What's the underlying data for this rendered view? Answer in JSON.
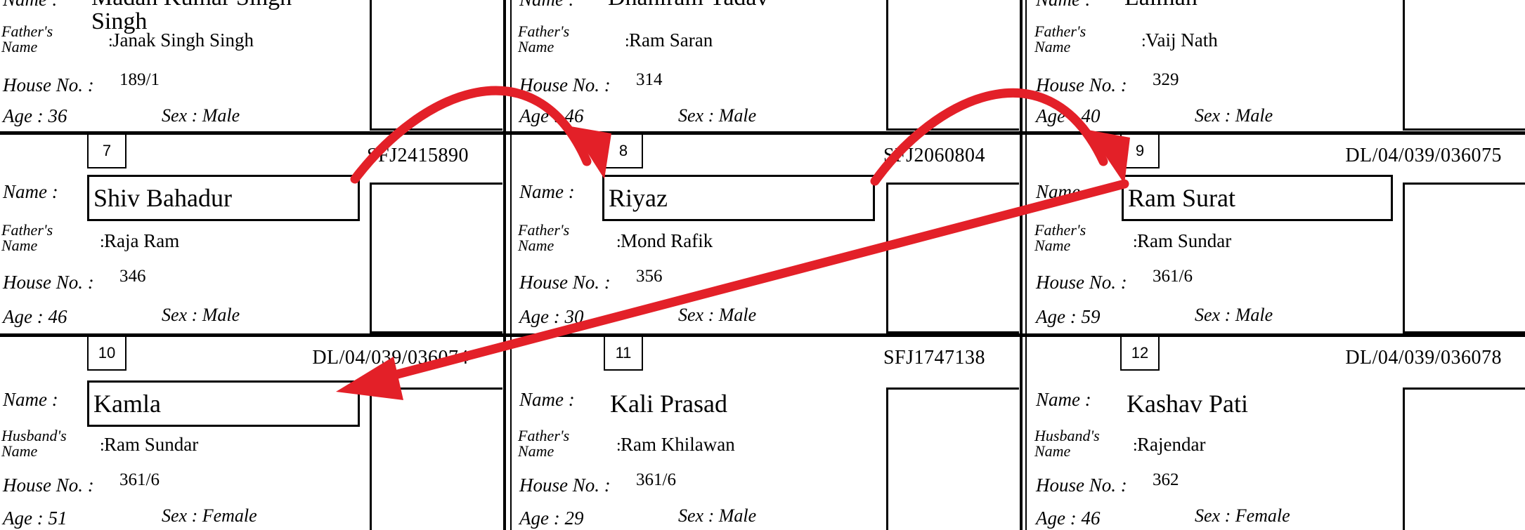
{
  "labels": {
    "name": "Name :",
    "fathers_name": "Father's Name",
    "husbands_name": "Husband's Name",
    "house_no": "House No. :",
    "age_prefix": "Age : ",
    "sex_prefix": "Sex : "
  },
  "top_row": [
    {
      "name": "Madan Kumar Singh Singh",
      "relative": "Janak Singh Singh",
      "relation_label": "Father's Name",
      "house_no": "189/1",
      "age": "Age : 36",
      "sex": "Sex : Male"
    },
    {
      "name": "Dhaniram Yadav",
      "relative": "Ram Saran",
      "relation_label": "Father's Name",
      "house_no": "314",
      "age": "Age : 46",
      "sex": "Sex : Male"
    },
    {
      "name": "Lalman",
      "relative": "Vaij Nath",
      "relation_label": "Father's Name",
      "house_no": "329",
      "age": "Age : 40",
      "sex": "Sex : Male"
    }
  ],
  "cards": [
    {
      "serial": "7",
      "epic": "SFJ2415890",
      "name": "Shiv Bahadur",
      "relation_label": "Father's Name",
      "relative": "Raja Ram",
      "house_no": "346",
      "age": "Age : 46",
      "sex": "Sex : Male",
      "boxed": true
    },
    {
      "serial": "8",
      "epic": "SFJ2060804",
      "name": "Riyaz",
      "relation_label": "Father's Name",
      "relative": "Mond Rafik",
      "house_no": "356",
      "age": "Age : 30",
      "sex": "Sex : Male",
      "boxed": true
    },
    {
      "serial": "9",
      "epic": "DL/04/039/036075",
      "name": "Ram Surat",
      "relation_label": "Father's Name",
      "relative": "Ram Sundar",
      "house_no": "361/6",
      "age": "Age : 59",
      "sex": "Sex : Male",
      "boxed": true
    },
    {
      "serial": "10",
      "epic": "DL/04/039/036074",
      "name": "Kamla",
      "relation_label": "Husband's Name",
      "relative": "Ram Sundar",
      "house_no": "361/6",
      "age": "Age : 51",
      "sex": "Sex : Female",
      "boxed": true
    },
    {
      "serial": "11",
      "epic": "SFJ1747138",
      "name": "Kali Prasad",
      "relation_label": "Father's Name",
      "relative": "Ram Khilawan",
      "house_no": "361/6",
      "age": "Age : 29",
      "sex": "Sex : Male",
      "boxed": false
    },
    {
      "serial": "12",
      "epic": "DL/04/039/036078",
      "name": "Kashav Pati",
      "relation_label": "Husband's Name",
      "relative": "Rajendar",
      "house_no": "362",
      "age": "Age : 46",
      "sex": "Sex : Female",
      "boxed": false
    }
  ],
  "annotation_color": "#e32028"
}
